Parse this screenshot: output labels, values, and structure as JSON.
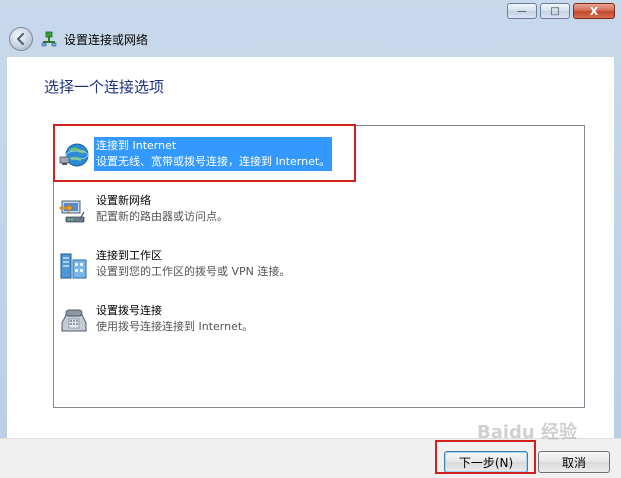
{
  "window": {
    "title": "设置连接或网络",
    "caption_buttons": {
      "minimize": "—",
      "maximize": "□",
      "close": "X"
    }
  },
  "nav": {
    "back_icon": "back-arrow-icon",
    "title_icon": "network-setup-icon",
    "title": "设置连接或网络"
  },
  "content": {
    "heading": "选择一个连接选项",
    "options": [
      {
        "title": "连接到 Internet",
        "description": "设置无线、宽带或拨号连接，连接到 Internet。",
        "icon": "globe-network-icon",
        "selected": true
      },
      {
        "title": "设置新网络",
        "description": "配置新的路由器或访问点。",
        "icon": "router-setup-icon",
        "selected": false
      },
      {
        "title": "连接到工作区",
        "description": "设置到您的工作区的拨号或 VPN 连接。",
        "icon": "workplace-server-icon",
        "selected": false
      },
      {
        "title": "设置拨号连接",
        "description": "使用拨号连接连接到 Internet。",
        "icon": "dialup-phone-icon",
        "selected": false
      }
    ]
  },
  "footer": {
    "next_label": "下一步(N)",
    "cancel_label": "取消"
  },
  "watermark": {
    "text": "Baidu 经验"
  },
  "colors": {
    "selection": "#3399ff",
    "heading": "#1e3287",
    "annotation": "#d21f1f"
  }
}
